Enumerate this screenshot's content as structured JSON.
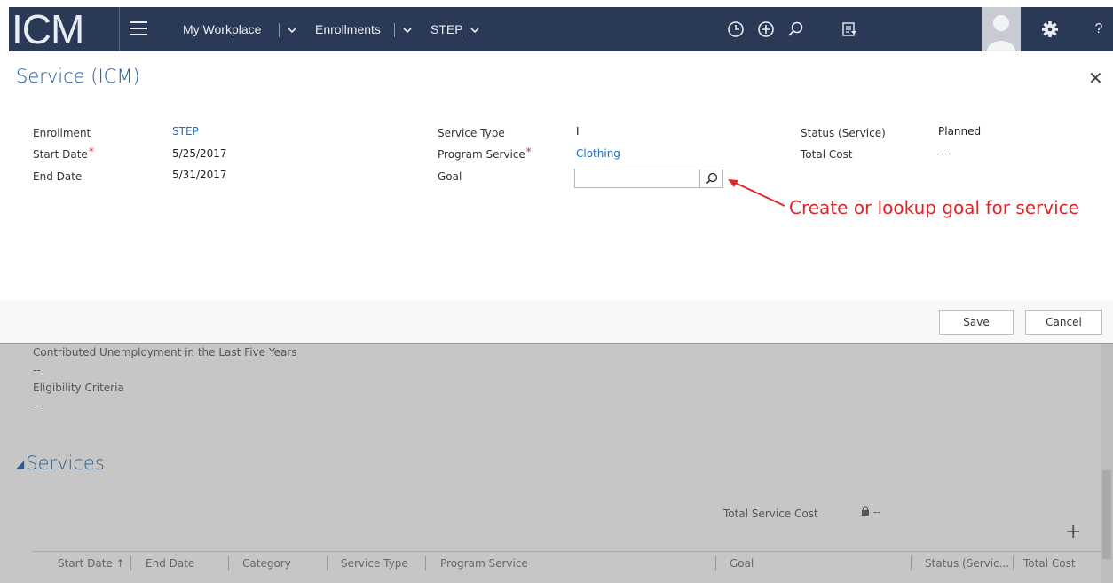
{
  "app": {
    "logo": "ICM"
  },
  "nav": {
    "items": [
      "My Workplace",
      "Enrollments",
      "STEP"
    ],
    "help": "?"
  },
  "form": {
    "title": "Service (ICM)",
    "fields_left": [
      {
        "label": "Enrollment",
        "value": "STEP",
        "link": true,
        "required": false
      },
      {
        "label": "Start Date",
        "value": "5/25/2017",
        "link": false,
        "required": true
      },
      {
        "label": "End Date",
        "value": "5/31/2017",
        "link": false,
        "required": false
      }
    ],
    "fields_mid": [
      {
        "label": "Service Type",
        "value": "I",
        "link": false,
        "required": false
      },
      {
        "label": "Program Service",
        "value": "Clothing",
        "link": true,
        "required": true
      },
      {
        "label": "Goal",
        "value": "",
        "link": false,
        "required": false
      }
    ],
    "fields_right": [
      {
        "label": "Status (Service)",
        "value": "Planned"
      },
      {
        "label": "Total Cost",
        "value": "--"
      }
    ],
    "required_marker": "*",
    "annotation": "Create or lookup goal for service",
    "save_label": "Save",
    "cancel_label": "Cancel"
  },
  "background": {
    "field1_label": "Contributed Unemployment in the Last Five Years",
    "field1_value": "--",
    "field2_label": "Eligibility Criteria",
    "field2_value": "--",
    "section_title": "Services",
    "total_label": "Total Service Cost",
    "total_value": "--",
    "add_label": "+",
    "columns": [
      "Start Date ↑",
      "End Date",
      "Category",
      "Service Type",
      "Program Service",
      "Goal",
      "Status (Servic...",
      "Total Cost"
    ]
  },
  "colors": {
    "topbar": "#2a3a56",
    "link": "#1f6fbf",
    "title": "#1f5aa3",
    "required": "#e0252a",
    "annotation": "#e0252a"
  }
}
